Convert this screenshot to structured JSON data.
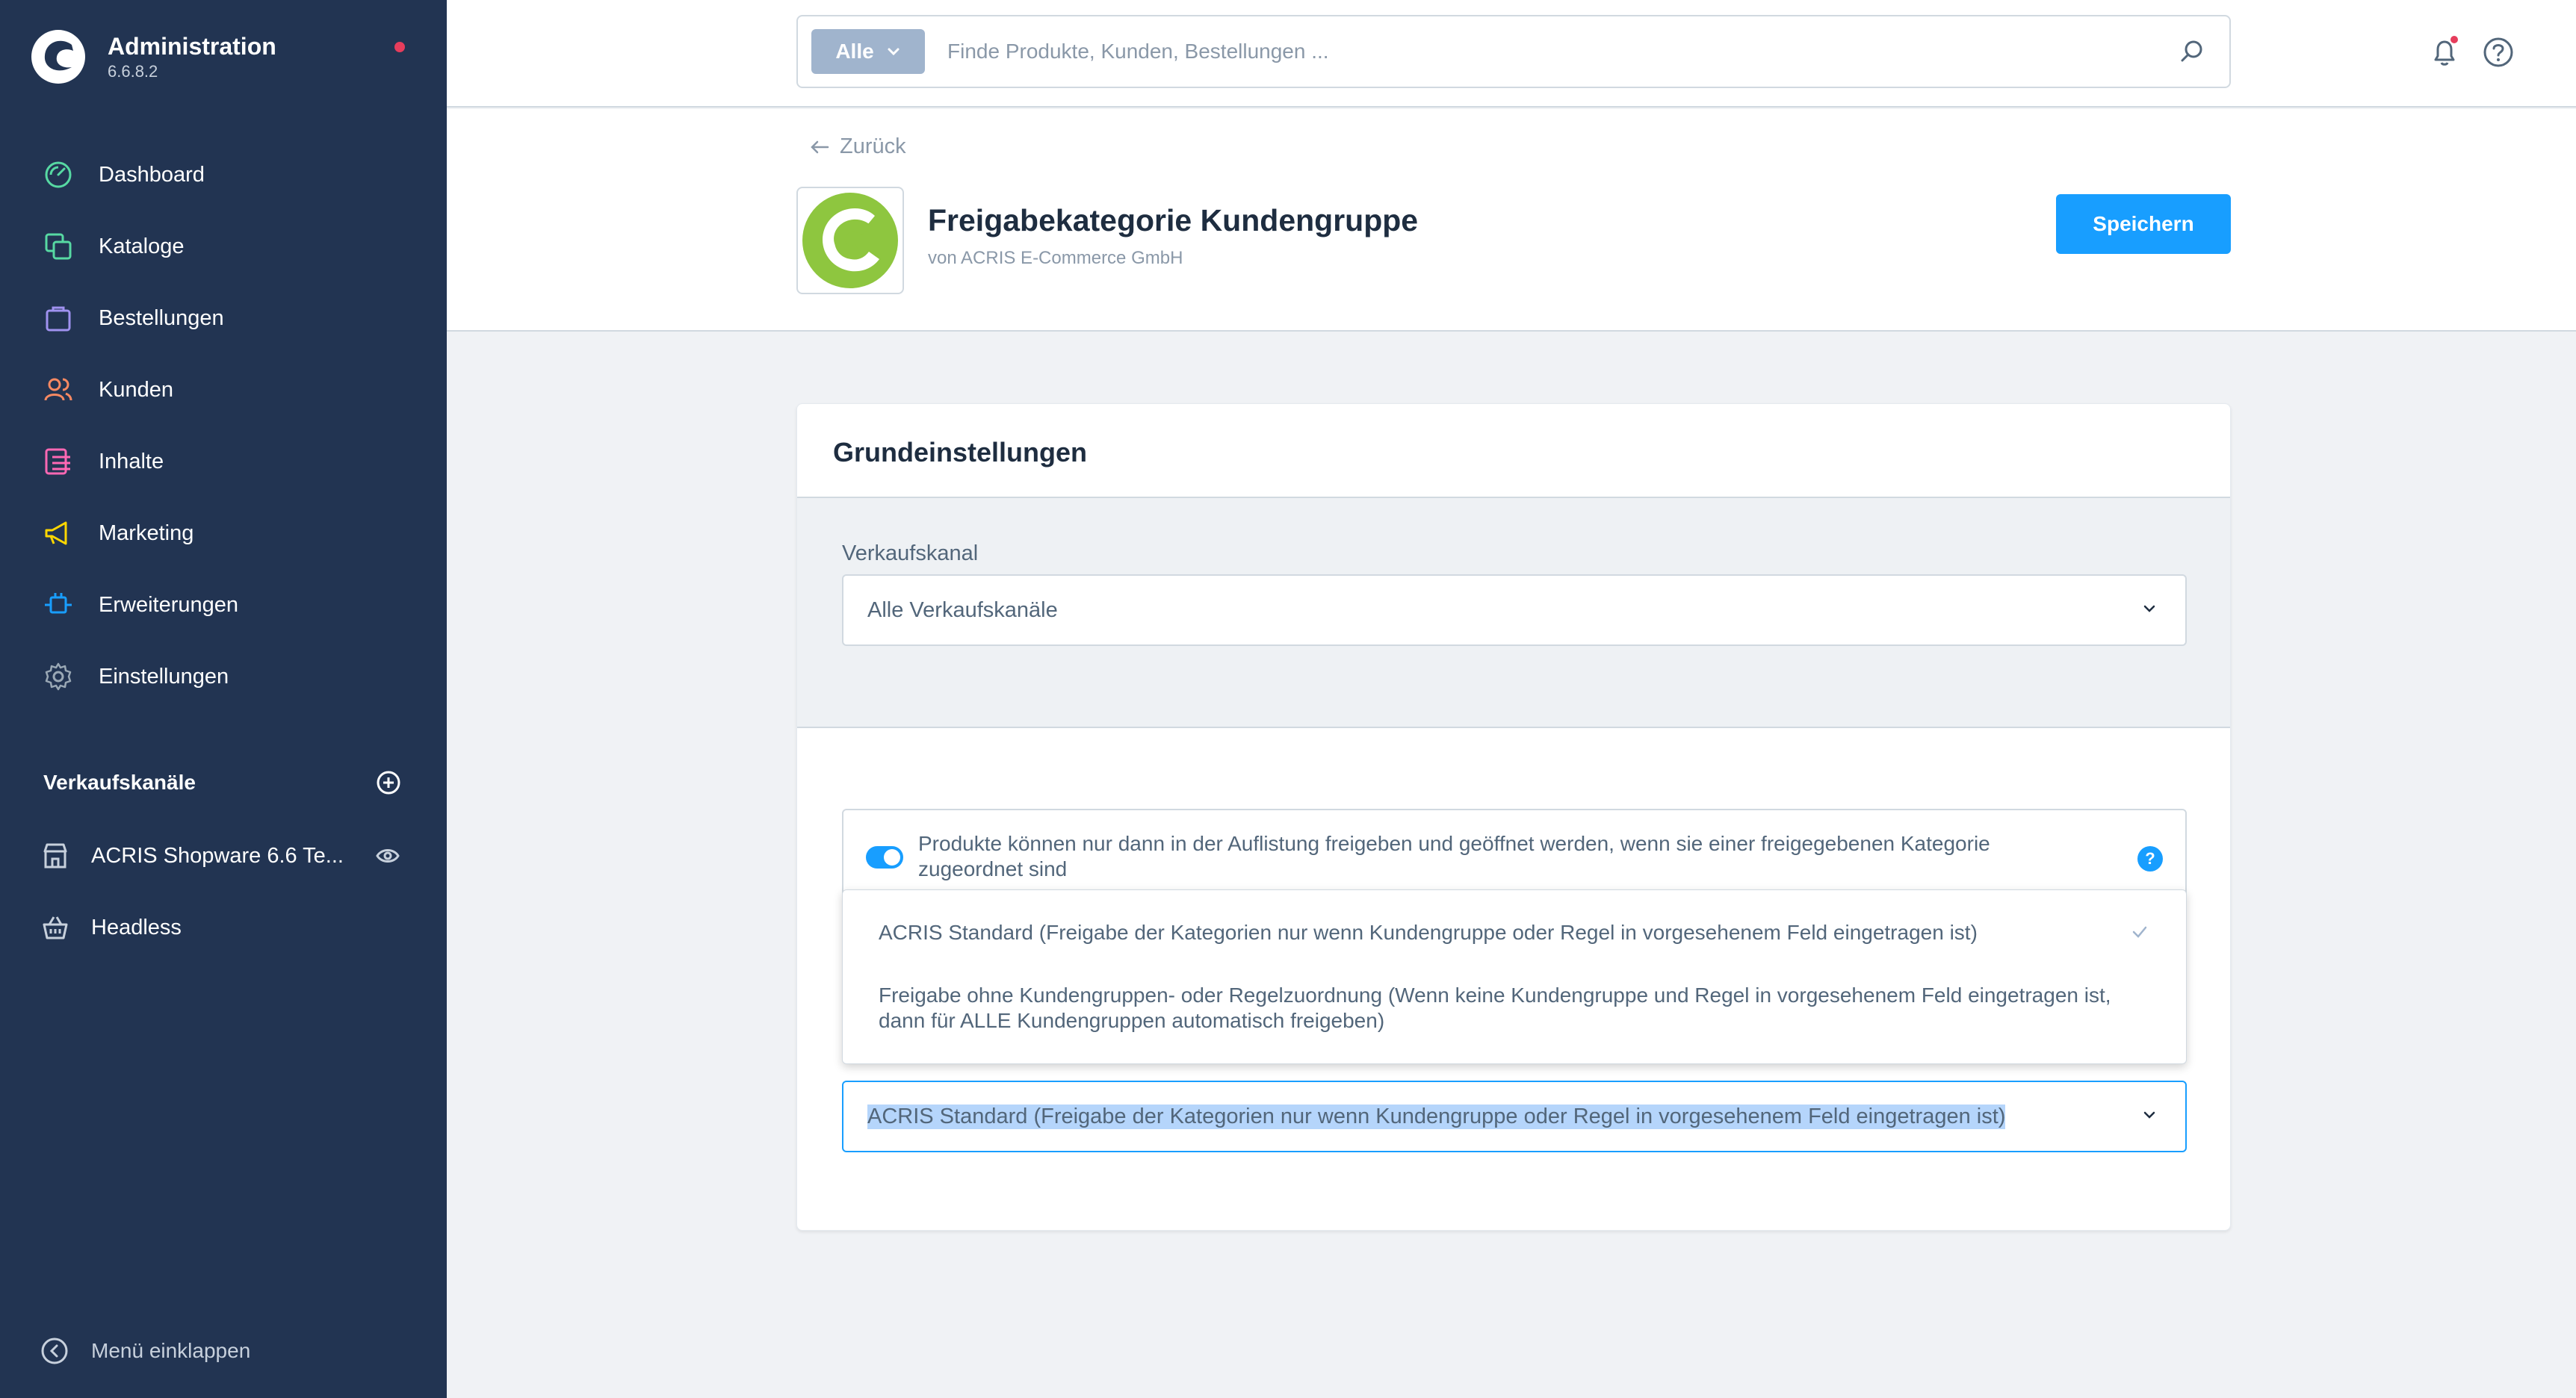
{
  "brand": {
    "title": "Administration",
    "version": "6.6.8.2"
  },
  "nav": [
    {
      "label": "Dashboard",
      "icon": "dashboard-icon",
      "color": "#57d9a3"
    },
    {
      "label": "Kataloge",
      "icon": "catalog-icon",
      "color": "#57d9a3"
    },
    {
      "label": "Bestellungen",
      "icon": "orders-icon",
      "color": "#a092f0"
    },
    {
      "label": "Kunden",
      "icon": "customers-icon",
      "color": "#f88962"
    },
    {
      "label": "Inhalte",
      "icon": "content-icon",
      "color": "#ff68b4"
    },
    {
      "label": "Marketing",
      "icon": "marketing-icon",
      "color": "#ffd700"
    },
    {
      "label": "Erweiterungen",
      "icon": "extensions-icon",
      "color": "#189eff"
    },
    {
      "label": "Einstellungen",
      "icon": "settings-icon",
      "color": "#9aa8b5"
    }
  ],
  "sales_channels": {
    "title": "Verkaufskanäle",
    "items": [
      {
        "label": "ACRIS Shopware 6.6 Te...",
        "icon": "storefront-icon"
      },
      {
        "label": "Headless",
        "icon": "headless-icon"
      }
    ]
  },
  "collapse_label": "Menü einklappen",
  "search": {
    "type_label": "Alle",
    "placeholder": "Finde Produkte, Kunden, Bestellungen ..."
  },
  "header": {
    "back_label": "Zurück",
    "title": "Freigabekategorie Kundengruppe",
    "vendor": "von ACRIS E-Commerce GmbH",
    "save_label": "Speichern"
  },
  "card": {
    "title": "Grundeinstellungen",
    "sales_channel_label": "Verkaufskanal",
    "sales_channel_value": "Alle Verkaufskanäle",
    "switch_label": "Produkte können nur dann in der Auflistung freigeben und geöffnet werden, wenn sie einer freigegebenen Kategorie zugeordnet sind",
    "switch_on": true,
    "options": [
      "ACRIS Standard (Freigabe der Kategorien nur wenn Kundengruppe oder Regel in vorgesehenem Feld eingetragen ist)",
      "Freigabe ohne Kundengruppen- oder Regelzuordnung (Wenn keine Kundengruppe und Regel in vorgesehenem Feld eingetragen ist, dann für ALLE Kundengruppen automatisch freigeben)"
    ],
    "selected_option": "ACRIS Standard (Freigabe der Kategorien nur wenn Kundengruppe oder Regel in vorgesehenem Feld eingetragen ist)"
  },
  "colors": {
    "sidebar": "#223452",
    "accent": "#189eff",
    "alert": "#e63d5c"
  }
}
